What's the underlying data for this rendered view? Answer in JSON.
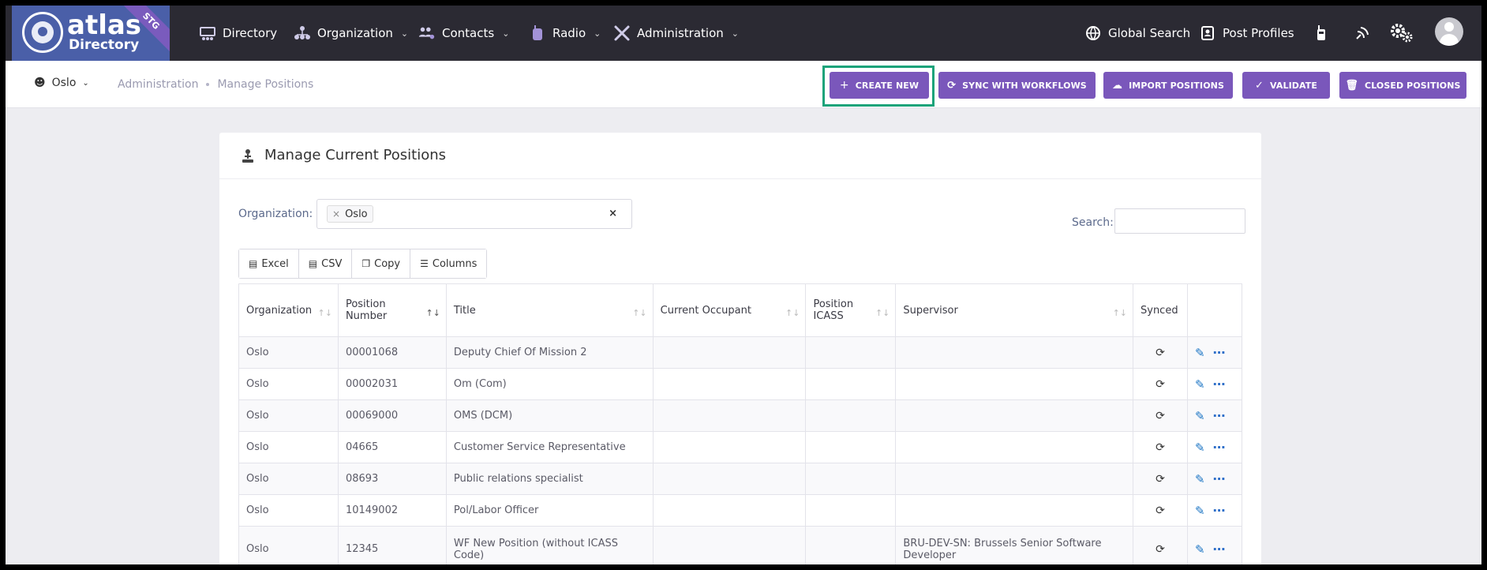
{
  "brand": {
    "logo_word": "atlas",
    "logo_sub": "Directory",
    "env_badge": "STG",
    "colors": {
      "nav_bg": "#2b2a33",
      "logo_bg": "#4a5fa8",
      "accent": "#7a57bb",
      "highlight": "#1aa37a"
    }
  },
  "nav": {
    "items": [
      {
        "label": "Directory",
        "icon": "directory-icon"
      },
      {
        "label": "Organization",
        "icon": "organization-icon"
      },
      {
        "label": "Contacts",
        "icon": "contacts-icon"
      },
      {
        "label": "Radio",
        "icon": "radio-icon"
      },
      {
        "label": "Administration",
        "icon": "administration-icon"
      }
    ],
    "global_search": "Global Search",
    "post_profiles": "Post Profiles"
  },
  "subheader": {
    "site": "Oslo",
    "breadcrumb": [
      "Administration",
      "Manage Positions"
    ],
    "actions": {
      "create_new": "CREATE NEW",
      "sync": "SYNC WITH WORKFLOWS",
      "import": "IMPORT POSITIONS",
      "validate": "VALIDATE",
      "closed": "CLOSED POSITIONS"
    }
  },
  "card": {
    "title": "Manage Current Positions",
    "org_label": "Organization:",
    "org_selected": "Oslo",
    "search_label": "Search:",
    "search_value": "",
    "tools": {
      "excel": "Excel",
      "csv": "CSV",
      "copy": "Copy",
      "columns": "Columns"
    }
  },
  "table": {
    "headers": {
      "organization": "Organization",
      "position_number": "Position Number",
      "title": "Title",
      "current_occupant": "Current Occupant",
      "position_icass": "Position ICASS",
      "supervisor": "Supervisor",
      "synced": "Synced"
    },
    "rows": [
      {
        "organization": "Oslo",
        "position_number": "00001068",
        "title": "Deputy Chief Of Mission 2",
        "current_occupant": "",
        "position_icass": "",
        "supervisor": ""
      },
      {
        "organization": "Oslo",
        "position_number": "00002031",
        "title": "Om (Com)",
        "current_occupant": "",
        "position_icass": "",
        "supervisor": ""
      },
      {
        "organization": "Oslo",
        "position_number": "00069000",
        "title": "OMS (DCM)",
        "current_occupant": "",
        "position_icass": "",
        "supervisor": ""
      },
      {
        "organization": "Oslo",
        "position_number": "04665",
        "title": "Customer Service Representative",
        "current_occupant": "",
        "position_icass": "",
        "supervisor": ""
      },
      {
        "organization": "Oslo",
        "position_number": "08693",
        "title": "Public relations specialist",
        "current_occupant": "",
        "position_icass": "",
        "supervisor": ""
      },
      {
        "organization": "Oslo",
        "position_number": "10149002",
        "title": "Pol/Labor Officer",
        "current_occupant": "",
        "position_icass": "",
        "supervisor": ""
      },
      {
        "organization": "Oslo",
        "position_number": "12345",
        "title": "WF New Position (without ICASS Code)",
        "current_occupant": "",
        "position_icass": "",
        "supervisor": "BRU-DEV-SN: Brussels Senior Software Developer"
      }
    ]
  }
}
